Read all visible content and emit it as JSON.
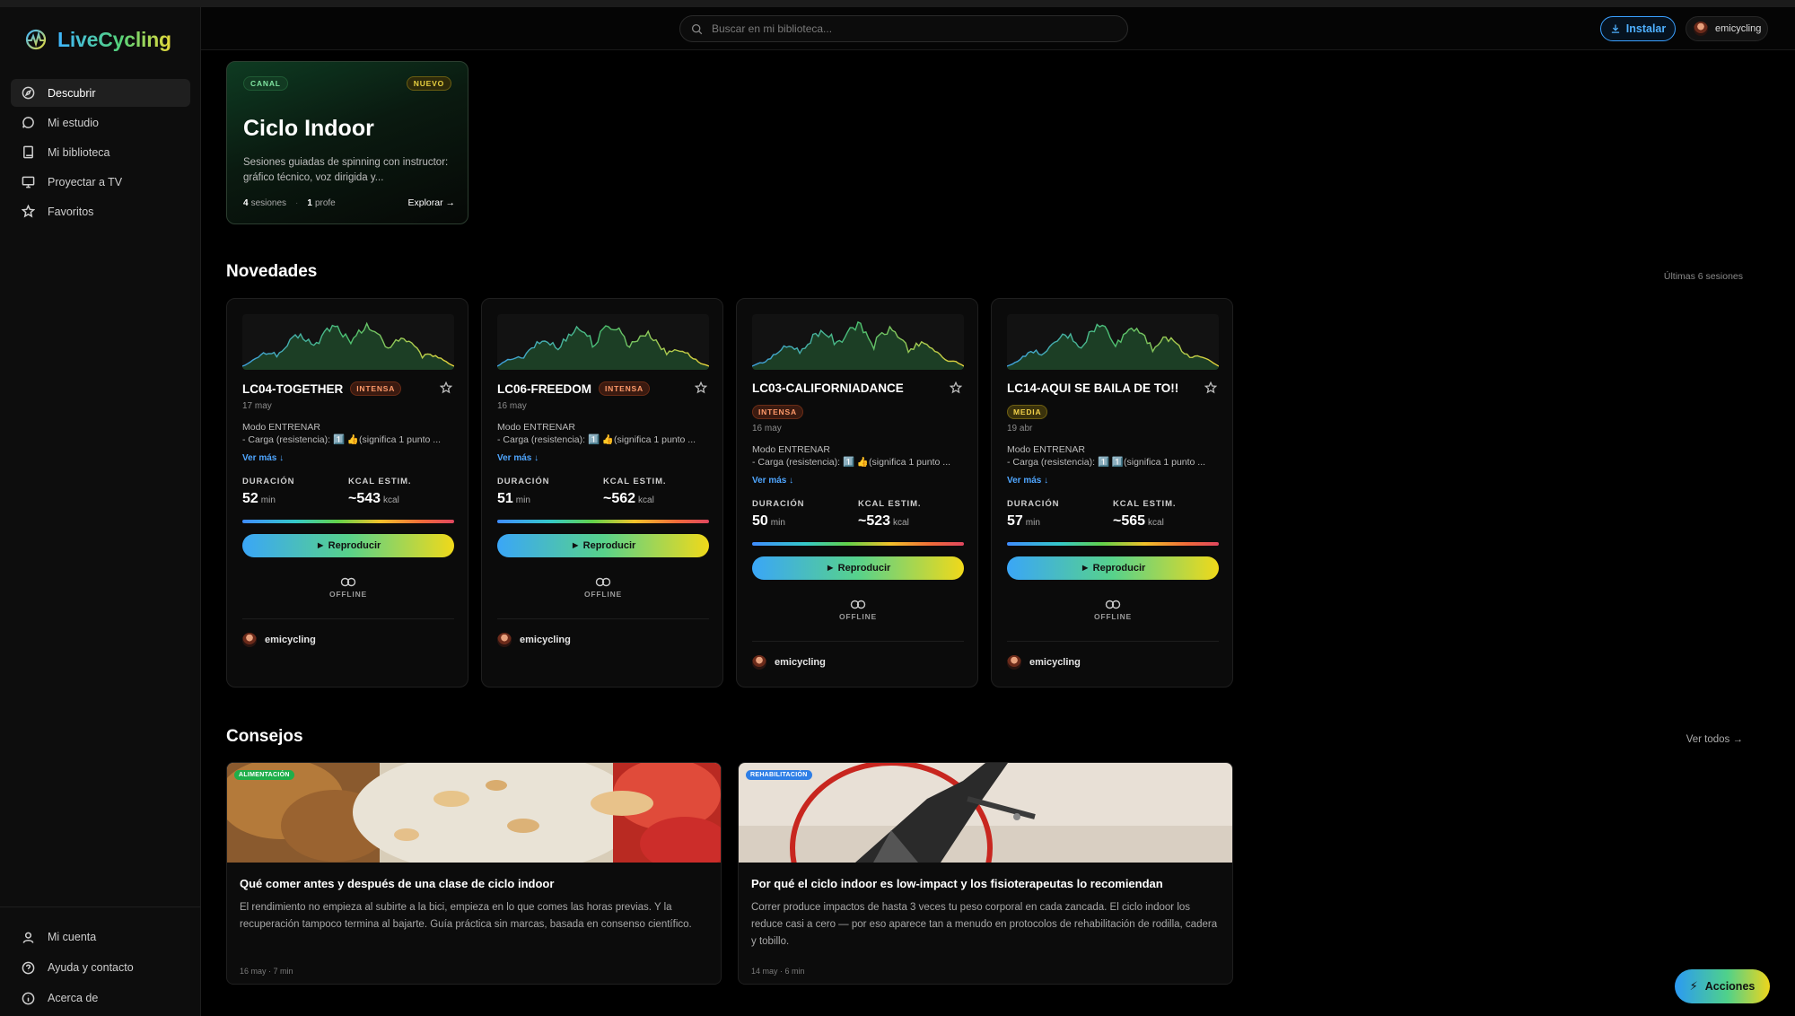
{
  "app": {
    "name": "LiveCycling"
  },
  "nav": {
    "items": [
      {
        "label": "Descubrir",
        "icon": "compass-icon",
        "active": true
      },
      {
        "label": "Mi estudio",
        "icon": "chat-bubble-icon",
        "active": false
      },
      {
        "label": "Mi biblioteca",
        "icon": "book-icon",
        "active": false
      },
      {
        "label": "Proyectar a TV",
        "icon": "monitor-icon",
        "active": false
      },
      {
        "label": "Favoritos",
        "icon": "star-icon",
        "active": false
      }
    ],
    "bottom": [
      {
        "label": "Mi cuenta",
        "icon": "user-icon"
      },
      {
        "label": "Ayuda y contacto",
        "icon": "help-icon"
      },
      {
        "label": "Acerca de",
        "icon": "info-icon"
      }
    ]
  },
  "topbar": {
    "search_placeholder": "Buscar en mi biblioteca...",
    "install_label": "Instalar",
    "username": "emicycling"
  },
  "channel": {
    "tag": "CANAL",
    "badge": "NUEVO",
    "title": "Ciclo Indoor",
    "description": "Sesiones guiadas de spinning con instructor: gráfico técnico, voz dirigida y...",
    "sessions_count": "4",
    "sessions_label": "sesiones",
    "profe_count": "1",
    "profe_label": "profe",
    "explore_label": "Explorar →"
  },
  "novedades": {
    "title": "Novedades",
    "right_label": "Últimas 6 sesiones",
    "cards": [
      {
        "title": "LC04-TOGETHER",
        "intensity": "INTENSA",
        "level": "intensa",
        "date": "17 may",
        "mode": "Modo ENTRENAR",
        "desc": "- Carga (resistencia): 1️⃣ 👍(significa 1 punto ...",
        "more": "Ver más ↓",
        "duration_label": "DURACIÓN",
        "duration": "52",
        "duration_unit": "min",
        "kcal_label": "KCAL ESTIM.",
        "kcal": "~543",
        "kcal_unit": "kcal",
        "play": "► Reproducir",
        "offline": "OFFLINE",
        "author": "emicycling"
      },
      {
        "title": "LC06-FREEDOM",
        "intensity": "INTENSA",
        "level": "intensa",
        "date": "16 may",
        "mode": "Modo ENTRENAR",
        "desc": "- Carga (resistencia): 1️⃣ 👍(significa 1 punto ...",
        "more": "Ver más ↓",
        "duration_label": "DURACIÓN",
        "duration": "51",
        "duration_unit": "min",
        "kcal_label": "KCAL ESTIM.",
        "kcal": "~562",
        "kcal_unit": "kcal",
        "play": "► Reproducir",
        "offline": "OFFLINE",
        "author": "emicycling"
      },
      {
        "title": "LC03-CALIFORNIADANCE",
        "intensity": "INTENSA",
        "level": "intensa",
        "date": "16 may",
        "mode": "Modo ENTRENAR",
        "desc": "- Carga (resistencia): 1️⃣ 👍(significa 1 punto ...",
        "more": "Ver más ↓",
        "duration_label": "DURACIÓN",
        "duration": "50",
        "duration_unit": "min",
        "kcal_label": "KCAL ESTIM.",
        "kcal": "~523",
        "kcal_unit": "kcal",
        "play": "► Reproducir",
        "offline": "OFFLINE",
        "author": "emicycling"
      },
      {
        "title": "LC14-AQUI SE BAILA DE TO!!",
        "intensity": "MEDIA",
        "level": "media",
        "date": "19 abr",
        "mode": "Modo ENTRENAR",
        "desc": "- Carga (resistencia): 1️⃣ 1️⃣(significa 1 punto ...",
        "more": "Ver más ↓",
        "duration_label": "DURACIÓN",
        "duration": "57",
        "duration_unit": "min",
        "kcal_label": "KCAL ESTIM.",
        "kcal": "~565",
        "kcal_unit": "kcal",
        "play": "► Reproducir",
        "offline": "OFFLINE",
        "author": "emicycling"
      }
    ]
  },
  "consejos": {
    "title": "Consejos",
    "right_label": "Ver todos →",
    "tips": [
      {
        "tag": "ALIMENTACIÓN",
        "tag_color": "#1fae4a",
        "title": "Qué comer antes y después de una clase de ciclo indoor",
        "desc": "El rendimiento no empieza al subirte a la bici, empieza en lo que comes las horas previas. Y la recuperación tampoco termina al bajarte. Guía práctica sin marcas, basada en consenso científico.",
        "meta": "16 may · 7 min"
      },
      {
        "tag": "REHABILITACIÓN",
        "tag_color": "#2f7fe6",
        "title": "Por qué el ciclo indoor es low-impact y los fisioterapeutas lo recomiendan",
        "desc": "Correr produce impactos de hasta 3 veces tu peso corporal en cada zancada. El ciclo indoor los reduce casi a cero — por eso aparece tan a menudo en protocolos de rehabilitación de rodilla, cadera y tobillo.",
        "meta": "14 may · 6 min"
      }
    ]
  },
  "actions": {
    "label": "Acciones"
  },
  "colors": {
    "accent_blue": "#3aa0ff",
    "accent_green": "#55d27a",
    "accent_yellow": "#e6d93a",
    "background": "#000000"
  }
}
